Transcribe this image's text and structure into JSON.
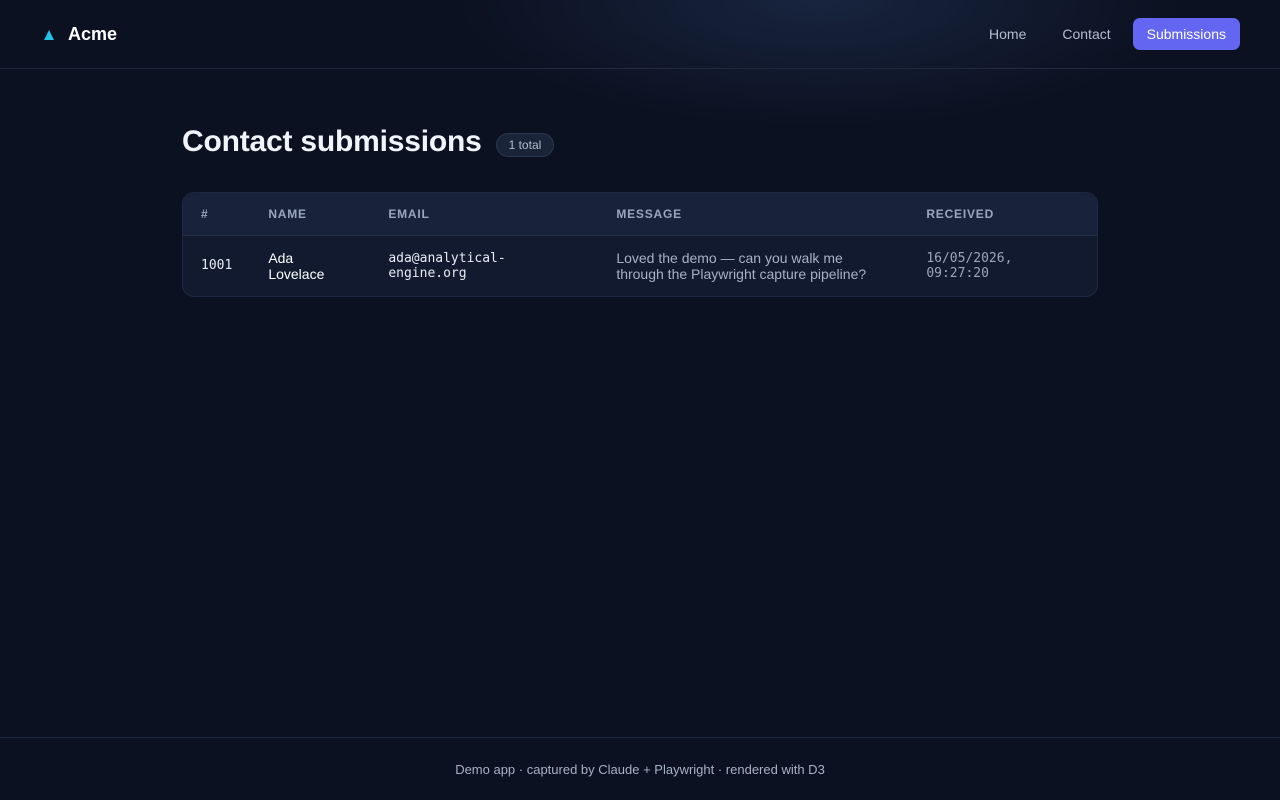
{
  "brand": {
    "icon": "triangle-icon",
    "icon_glyph": "▲",
    "name": "Acme",
    "accent_color": "#22c3e6"
  },
  "nav": {
    "items": [
      {
        "label": "Home",
        "active": false
      },
      {
        "label": "Contact",
        "active": false
      },
      {
        "label": "Submissions",
        "active": true
      }
    ],
    "active_color": "#6366f1"
  },
  "page": {
    "title": "Contact submissions",
    "count_badge": "1 total"
  },
  "table": {
    "columns": [
      "#",
      "NAME",
      "EMAIL",
      "MESSAGE",
      "RECEIVED"
    ],
    "rows": [
      {
        "id": "1001",
        "name": "Ada Lovelace",
        "email": "ada@analytical-engine.org",
        "message": "Loved the demo — can you walk me through the Playwright capture pipeline?",
        "received": "16/05/2026, 09:27:20"
      }
    ]
  },
  "footer": {
    "text": "Demo app · captured by Claude + Playwright · rendered with D3"
  }
}
